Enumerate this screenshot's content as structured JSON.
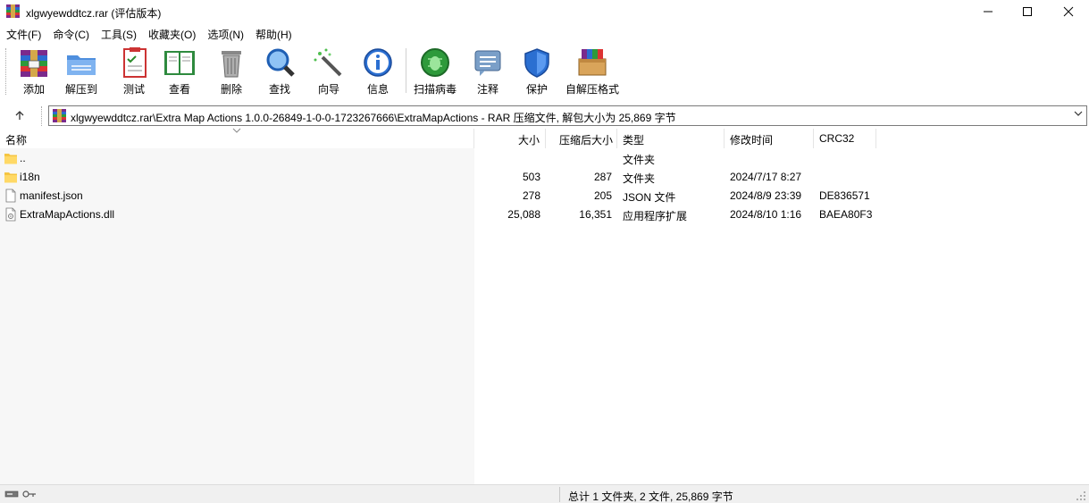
{
  "window": {
    "title": "xlgwyewddtcz.rar (评估版本)"
  },
  "menu": [
    "文件(F)",
    "命令(C)",
    "工具(S)",
    "收藏夹(O)",
    "选项(N)",
    "帮助(H)"
  ],
  "toolbar": {
    "add": "添加",
    "extract": "解压到",
    "test": "测试",
    "view": "查看",
    "delete": "删除",
    "find": "查找",
    "wizard": "向导",
    "info": "信息",
    "virus": "扫描病毒",
    "comment": "注释",
    "protect": "保护",
    "sfx": "自解压格式"
  },
  "address": {
    "path": "xlgwyewddtcz.rar\\Extra Map Actions 1.0.0-26849-1-0-0-1723267666\\ExtraMapActions - RAR 压缩文件, 解包大小为 25,869 字节"
  },
  "columns": {
    "name": "名称",
    "size": "大小",
    "packed": "压缩后大小",
    "type": "类型",
    "modified": "修改时间",
    "crc": "CRC32"
  },
  "files": [
    {
      "name": "..",
      "size": "",
      "packed": "",
      "type": "文件夹",
      "modified": "",
      "crc": "",
      "icon": "folder-icon"
    },
    {
      "name": "i18n",
      "size": "503",
      "packed": "287",
      "type": "文件夹",
      "modified": "2024/7/17 8:27",
      "crc": "",
      "icon": "folder-icon"
    },
    {
      "name": "manifest.json",
      "size": "278",
      "packed": "205",
      "type": "JSON 文件",
      "modified": "2024/8/9 23:39",
      "crc": "DE836571",
      "icon": "document-icon"
    },
    {
      "name": "ExtraMapActions.dll",
      "size": "25,088",
      "packed": "16,351",
      "type": "应用程序扩展",
      "modified": "2024/8/10 1:16",
      "crc": "BAEA80F3",
      "icon": "dll-file-icon"
    }
  ],
  "status": {
    "summary": "总计 1 文件夹, 2 文件, 25,869 字节"
  }
}
